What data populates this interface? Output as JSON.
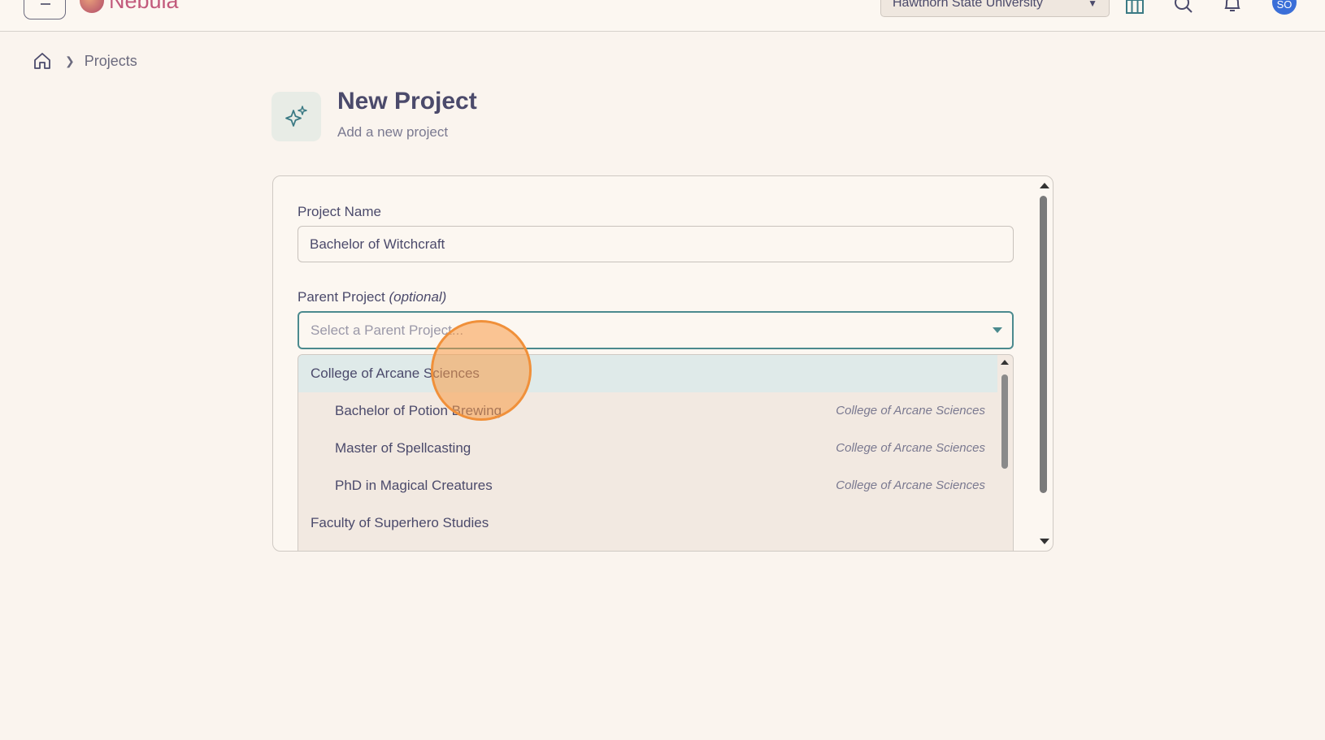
{
  "topbar": {
    "brand": "Nebula",
    "org_select": "Hawthorn State University",
    "avatar_initials": "SO"
  },
  "breadcrumb": {
    "current": "Projects"
  },
  "header": {
    "title": "New Project",
    "subtitle": "Add a new project"
  },
  "form": {
    "project_name_label": "Project Name",
    "project_name_value": "Bachelor of Witchcraft",
    "parent_label": "Parent Project",
    "parent_label_suffix": "(optional)",
    "parent_placeholder": "Select a Parent Project..."
  },
  "dropdown": {
    "options": [
      {
        "label": "College of Arcane Sciences",
        "parent": ""
      },
      {
        "label": "Bachelor of Potion Brewing",
        "parent": "College of Arcane Sciences"
      },
      {
        "label": "Master of Spellcasting",
        "parent": "College of Arcane Sciences"
      },
      {
        "label": "PhD in Magical Creatures",
        "parent": "College of Arcane Sciences"
      },
      {
        "label": "Faculty of Superhero Studies",
        "parent": ""
      }
    ]
  },
  "colors": {
    "accent": "#4b8a8e",
    "highlight": "#dfeae9",
    "brand": "#c25a7c"
  }
}
